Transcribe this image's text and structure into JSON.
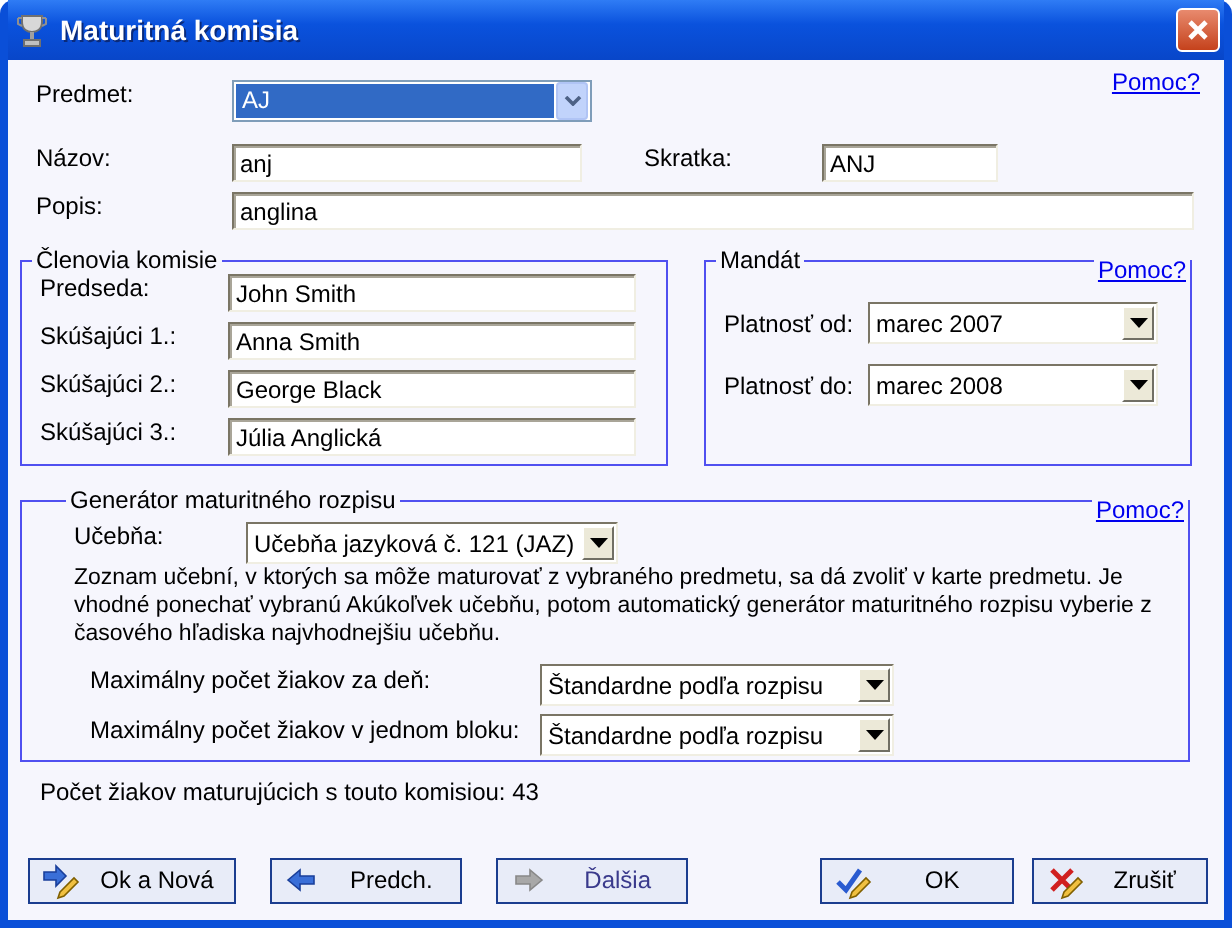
{
  "window": {
    "title": "Maturitná komisia"
  },
  "help_link": "Pomoc?",
  "subject": {
    "label": "Predmet:",
    "value": "AJ",
    "focused": true
  },
  "name": {
    "label": "Názov:",
    "value": "anj"
  },
  "abbreviation": {
    "label": "Skratka:",
    "value": "ANJ"
  },
  "description": {
    "label": "Popis:",
    "value": "anglina"
  },
  "members": {
    "title": "Členovia komisie",
    "rows": [
      {
        "label": "Predseda:",
        "value": "John Smith"
      },
      {
        "label": "Skúšajúci 1.:",
        "value": "Anna Smith"
      },
      {
        "label": "Skúšajúci 2.:",
        "value": "George Black"
      },
      {
        "label": "Skúšajúci 3.:",
        "value": "Júlia Anglická"
      }
    ]
  },
  "mandate": {
    "title": "Mandát",
    "help_link": "Pomoc?",
    "rows": [
      {
        "label": "Platnosť od:",
        "value": "marec 2007"
      },
      {
        "label": "Platnosť do:",
        "value": "marec 2008"
      }
    ]
  },
  "generator": {
    "title": "Generátor maturitného rozpisu",
    "help_link": "Pomoc?",
    "classroom": {
      "label": "Učebňa:",
      "value": "Učebňa jazyková č. 121 (JAZ)"
    },
    "note": "Zoznam učební, v ktorých sa môže maturovať z vybraného predmetu, sa dá zvoliť v karte predmetu. Je vhodné ponechať vybranú Akúkoľvek učebňu, potom automatický generátor maturitného rozpisu vyberie z časového hľadiska najvhodnejšiu učebňu.",
    "limits": [
      {
        "label": "Maximálny počet žiakov za deň:",
        "value": "Štandardne podľa rozpisu"
      },
      {
        "label": "Maximálny počet žiakov v jednom bloku:",
        "value": "Štandardne podľa rozpisu"
      }
    ]
  },
  "student_count": "Počet žiakov maturujúcich s touto komisiou: 43",
  "buttons": [
    {
      "kind": "save-new",
      "label": "Ok a Nová",
      "disabled": false
    },
    {
      "kind": "previous",
      "label": "Predch.",
      "disabled": false
    },
    {
      "kind": "next",
      "label": "Ďalšia",
      "disabled": true
    },
    {
      "kind": "ok",
      "label": "OK",
      "disabled": false
    },
    {
      "kind": "cancel",
      "label": "Zrušiť",
      "disabled": false
    }
  ]
}
